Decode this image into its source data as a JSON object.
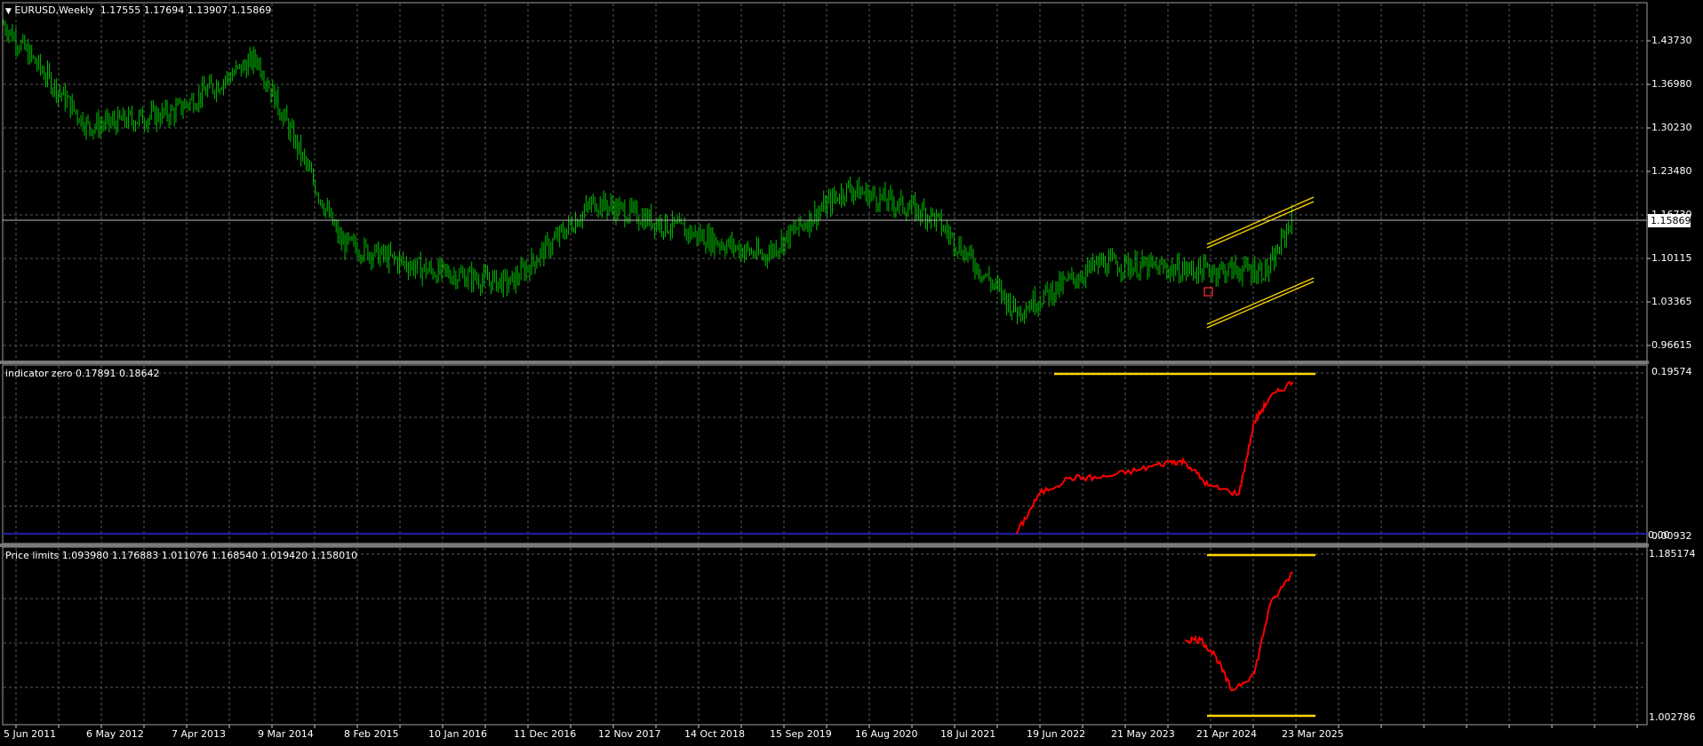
{
  "main": {
    "symbol_label": "EURUSD,Weekly",
    "ohlc": "1.17555 1.17694 1.13907 1.15869",
    "current_price": "1.15869",
    "price_ticks": [
      "1.43730",
      "1.36980",
      "1.30230",
      "1.23480",
      "1.16730",
      "1.10115",
      "1.03365",
      "0.96615"
    ]
  },
  "indicator_zero": {
    "label": "indicator zero 0.17891 0.18642",
    "ticks": [
      "0.19574",
      "0.00932"
    ],
    "zero_label": "0.00"
  },
  "price_limits": {
    "label": "Price limits 1.093980 1.176883 1.011076 1.168540 1.019420 1.158010",
    "ticks": [
      "1.185174",
      "1.002786"
    ]
  },
  "time_axis": [
    "5 Jun 2011",
    "6 May 2012",
    "7 Apr 2013",
    "9 Mar 2014",
    "8 Feb 2015",
    "10 Jan 2016",
    "11 Dec 2016",
    "12 Nov 2017",
    "14 Oct 2018",
    "15 Sep 2019",
    "16 Aug 2020",
    "18 Jul 2021",
    "19 Jun 2022",
    "21 May 2023",
    "21 Apr 2024",
    "23 Mar 2025"
  ],
  "colors": {
    "background": "#000000",
    "grid": "#5a5a5a",
    "candles": "#00c000",
    "indicator": "#ff0000",
    "limits": "#ffd700",
    "zero_line": "#1e1eaa",
    "frame": "#a0a0a0"
  },
  "chart_data": [
    {
      "type": "line",
      "name": "EURUSD,Weekly",
      "x": [
        "2011-06",
        "2012-05",
        "2013-04",
        "2014-03",
        "2015-02",
        "2016-01",
        "2016-12",
        "2017-11",
        "2018-10",
        "2019-09",
        "2020-08",
        "2021-07",
        "2022-06",
        "2023-05",
        "2024-04",
        "2025-03",
        "2025-06"
      ],
      "y": [
        1.44,
        1.29,
        1.31,
        1.39,
        1.12,
        1.08,
        1.06,
        1.18,
        1.14,
        1.1,
        1.2,
        1.16,
        1.02,
        1.09,
        1.08,
        1.08,
        1.16
      ],
      "ylim": [
        0.95,
        1.47
      ]
    },
    {
      "type": "line",
      "name": "indicator zero",
      "x": [
        "2022-06",
        "2022-09",
        "2023-01",
        "2023-05",
        "2023-10",
        "2024-02",
        "2024-04",
        "2024-07",
        "2024-11",
        "2025-01",
        "2025-03",
        "2025-06"
      ],
      "y": [
        0.0,
        0.05,
        0.07,
        0.07,
        0.08,
        0.09,
        0.09,
        0.06,
        0.05,
        0.14,
        0.17,
        0.19
      ],
      "ylim": [
        0.0,
        0.2
      ]
    },
    {
      "type": "line",
      "name": "Price limits",
      "x": [
        "2024-04",
        "2024-06",
        "2024-08",
        "2024-10",
        "2025-01",
        "2025-03",
        "2025-06"
      ],
      "y": [
        1.09,
        1.09,
        1.07,
        1.03,
        1.05,
        1.13,
        1.17
      ],
      "ylim": [
        1.0,
        1.19
      ]
    }
  ]
}
